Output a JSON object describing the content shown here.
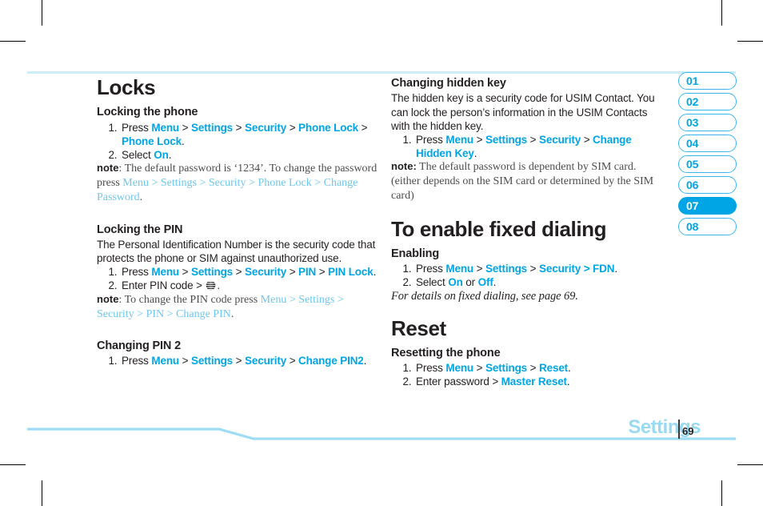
{
  "document": {
    "footer_section": "Settings",
    "page_number": "69"
  },
  "side_tabs": {
    "items": [
      {
        "label": "01",
        "active": false
      },
      {
        "label": "02",
        "active": false
      },
      {
        "label": "03",
        "active": false
      },
      {
        "label": "04",
        "active": false
      },
      {
        "label": "05",
        "active": false
      },
      {
        "label": "06",
        "active": false
      },
      {
        "label": "07",
        "active": true
      },
      {
        "label": "08",
        "active": false
      }
    ]
  },
  "left_column": {
    "title": "Locks",
    "section1": {
      "heading": "Locking the phone",
      "step1": {
        "press": "Press",
        "l1": "Menu",
        "l2": "Settings",
        "l3": "Security",
        "l4": "Phone Lock",
        "l5": "Phone Lock",
        "period": "."
      },
      "step2": {
        "select": "Select",
        "value": "On",
        "period": "."
      },
      "note": {
        "label": "note",
        "t1": ": The default password is ‘1234’. To change the password press ",
        "l1": "Menu",
        "l2": "Settings",
        "l3": "Security",
        "l4": "Phone Lock",
        "l5": "Change Password",
        "period": "."
      }
    },
    "section2": {
      "heading": "Locking the PIN",
      "body": "The Personal Identification Number is the security code that protects the phone or SIM against unauthorized use.",
      "step1": {
        "press": "Press",
        "l1": "Menu",
        "l2": "Settings",
        "l3": "Security",
        "l4": "PIN",
        "l5": "PIN Lock",
        "period": "."
      },
      "step2": {
        "text": "Enter PIN code",
        "icon": "att-globe-icon",
        "period": "."
      },
      "note": {
        "label": "note",
        "t1": ": To change the PIN code press ",
        "l1": "Menu",
        "l2": "Settings",
        "l3": "Security",
        "l4": "PIN",
        "l5": "Change PIN",
        "period": "."
      }
    },
    "section3": {
      "heading": "Changing PIN 2",
      "step1": {
        "press": "Press",
        "l1": "Menu",
        "l2": "Settings",
        "l3": "Security",
        "l4": "Change PIN2",
        "period": "."
      }
    }
  },
  "right_column": {
    "section1": {
      "heading": "Changing hidden key",
      "body": "The hidden key is a security code for USIM Contact. You can lock the person’s information in the USIM Contacts with the hidden key.",
      "step1": {
        "press": "Press",
        "l1": "Menu",
        "l2": "Settings",
        "l3": "Security",
        "l4": "Change Hidden Key",
        "period": "."
      },
      "note": {
        "label": "note:",
        "t1": " The default password is dependent by SIM card. (either depends on the SIM card or determined by the SIM card)"
      }
    },
    "section2": {
      "title": "To enable fixed dialing",
      "heading": "Enabling",
      "step1": {
        "press": "Press",
        "l1": "Menu",
        "l2": "Settings",
        "l3": "Security",
        "l4": "FDN",
        "period": "."
      },
      "step2": {
        "select": "Select",
        "v1": "On",
        "or": "or",
        "v2": "Off",
        "period": "."
      },
      "ref": "For details on fixed dialing, see page 69."
    },
    "section3": {
      "title": "Reset",
      "heading": "Resetting the phone",
      "step1": {
        "press": "Press",
        "l1": "Menu",
        "l2": "Settings",
        "l3": "Reset",
        "period": "."
      },
      "step2": {
        "text": "Enter password",
        "l1": "Master Reset",
        "period": "."
      }
    }
  },
  "separators": {
    "gt": ">"
  },
  "colors": {
    "link_blue": "#00a5e5",
    "rule_blue": "#cdedfb",
    "footer_blue": "#9ad9f2",
    "note_gray": "#4d4d4f"
  }
}
